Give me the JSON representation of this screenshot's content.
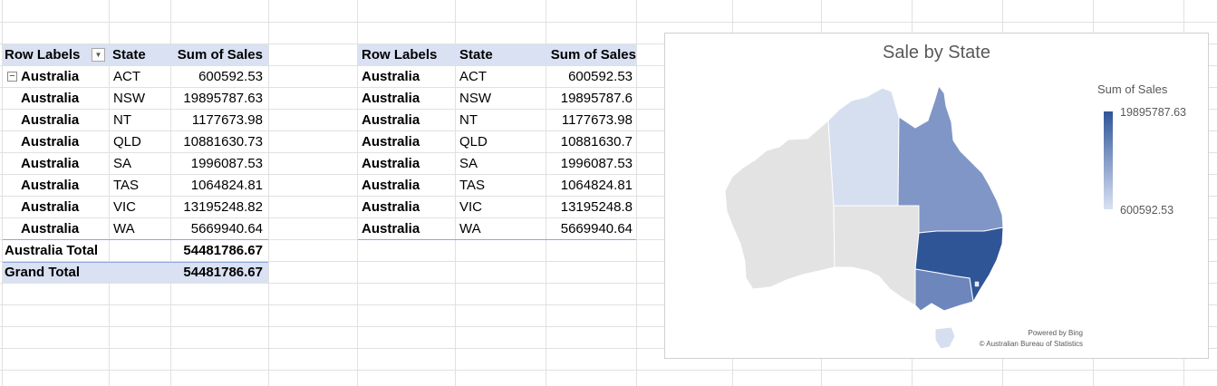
{
  "pivot": {
    "headers": [
      "Row Labels",
      "State",
      "Sum of Sales"
    ],
    "group_label": "Australia",
    "rows": [
      {
        "country": "Australia",
        "state": "ACT",
        "sales": "600592.53"
      },
      {
        "country": "Australia",
        "state": "NSW",
        "sales": "19895787.63"
      },
      {
        "country": "Australia",
        "state": "NT",
        "sales": "1177673.98"
      },
      {
        "country": "Australia",
        "state": "QLD",
        "sales": "10881630.73"
      },
      {
        "country": "Australia",
        "state": "SA",
        "sales": "1996087.53"
      },
      {
        "country": "Australia",
        "state": "TAS",
        "sales": "1064824.81"
      },
      {
        "country": "Australia",
        "state": "VIC",
        "sales": "13195248.82"
      },
      {
        "country": "Australia",
        "state": "WA",
        "sales": "5669940.64"
      }
    ],
    "subtotal_label": "Australia Total",
    "subtotal_value": "54481786.67",
    "grand_label": "Grand Total",
    "grand_value": "54481786.67"
  },
  "table2": {
    "headers": [
      "Row Labels",
      "State",
      "Sum of Sales"
    ],
    "rows": [
      {
        "country": "Australia",
        "state": "ACT",
        "sales": "600592.53"
      },
      {
        "country": "Australia",
        "state": "NSW",
        "sales": "19895787.6"
      },
      {
        "country": "Australia",
        "state": "NT",
        "sales": "1177673.98"
      },
      {
        "country": "Australia",
        "state": "QLD",
        "sales": "10881630.7"
      },
      {
        "country": "Australia",
        "state": "SA",
        "sales": "1996087.53"
      },
      {
        "country": "Australia",
        "state": "TAS",
        "sales": "1064824.81"
      },
      {
        "country": "Australia",
        "state": "VIC",
        "sales": "13195248.8"
      },
      {
        "country": "Australia",
        "state": "WA",
        "sales": "5669940.64"
      }
    ]
  },
  "map_chart": {
    "title": "Sale by State",
    "legend_title": "Sum of Sales",
    "legend_max": "19895787.63",
    "legend_min": "600592.53",
    "powered_by": "Powered by Bing",
    "copyright": "© Australian Bureau of Statistics",
    "colors": {
      "max": "#2f5597",
      "min": "#d9e2f3",
      "no_data": "#e3e3e3"
    },
    "state_fills": {
      "WA": "no-data",
      "SA": "no-data",
      "NT": "#d6dff0",
      "QLD": "#7f96c6",
      "NSW": "#2f5597",
      "VIC": "#6d87bd",
      "TAS": "#d6dff0",
      "ACT": "#e3e8f4"
    }
  }
}
